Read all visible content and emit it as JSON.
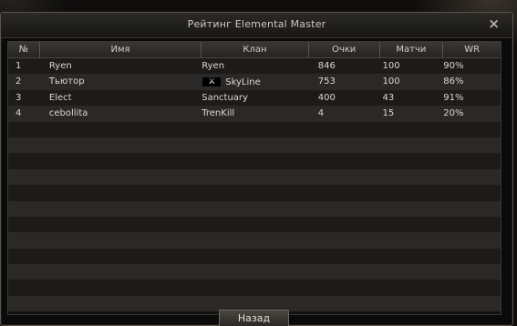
{
  "window": {
    "title": "Рейтинг Elemental Master",
    "close_label": "×"
  },
  "table": {
    "columns": [
      "№",
      "Имя",
      "Клан",
      "Очки",
      "Матчи",
      "WR"
    ],
    "rows": [
      {
        "rank": "1",
        "name": "Ryen",
        "clan": "Ryen",
        "clan_crest": false,
        "score": "846",
        "matches": "100",
        "wr": "90%"
      },
      {
        "rank": "2",
        "name": "Тьютор",
        "clan": "SkyLine",
        "clan_crest": true,
        "score": "753",
        "matches": "100",
        "wr": "86%"
      },
      {
        "rank": "3",
        "name": "Elect",
        "clan": "Sanctuary",
        "clan_crest": false,
        "score": "400",
        "matches": "43",
        "wr": "91%"
      },
      {
        "rank": "4",
        "name": "cebollita",
        "clan": "TrenKill",
        "clan_crest": false,
        "score": "4",
        "matches": "15",
        "wr": "20%"
      }
    ],
    "total_row_slots": 16
  },
  "footer": {
    "back_label": "Назад"
  }
}
